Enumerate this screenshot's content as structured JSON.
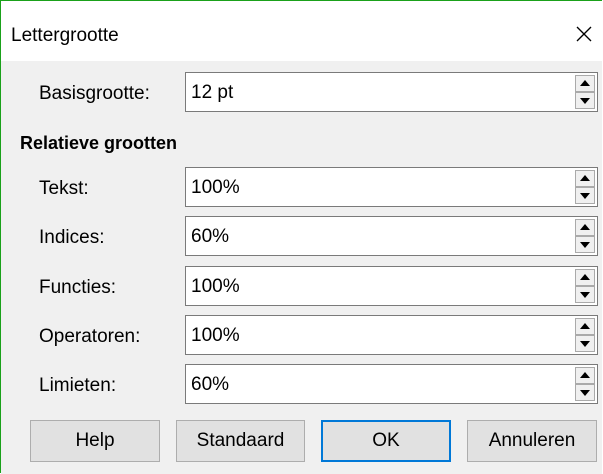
{
  "window": {
    "title": "Lettergrootte"
  },
  "base": {
    "label": "Basisgrootte:",
    "value": "12 pt"
  },
  "relative": {
    "heading": "Relatieve grootten",
    "rows": [
      {
        "label": "Tekst:",
        "value": "100%"
      },
      {
        "label": "Indices:",
        "value": "60%"
      },
      {
        "label": "Functies:",
        "value": "100%"
      },
      {
        "label": "Operatoren:",
        "value": "100%"
      },
      {
        "label": "Limieten:",
        "value": "60%"
      }
    ]
  },
  "buttons": {
    "help": "Help",
    "standaard": "Standaard",
    "ok": "OK",
    "annuleren": "Annuleren"
  }
}
